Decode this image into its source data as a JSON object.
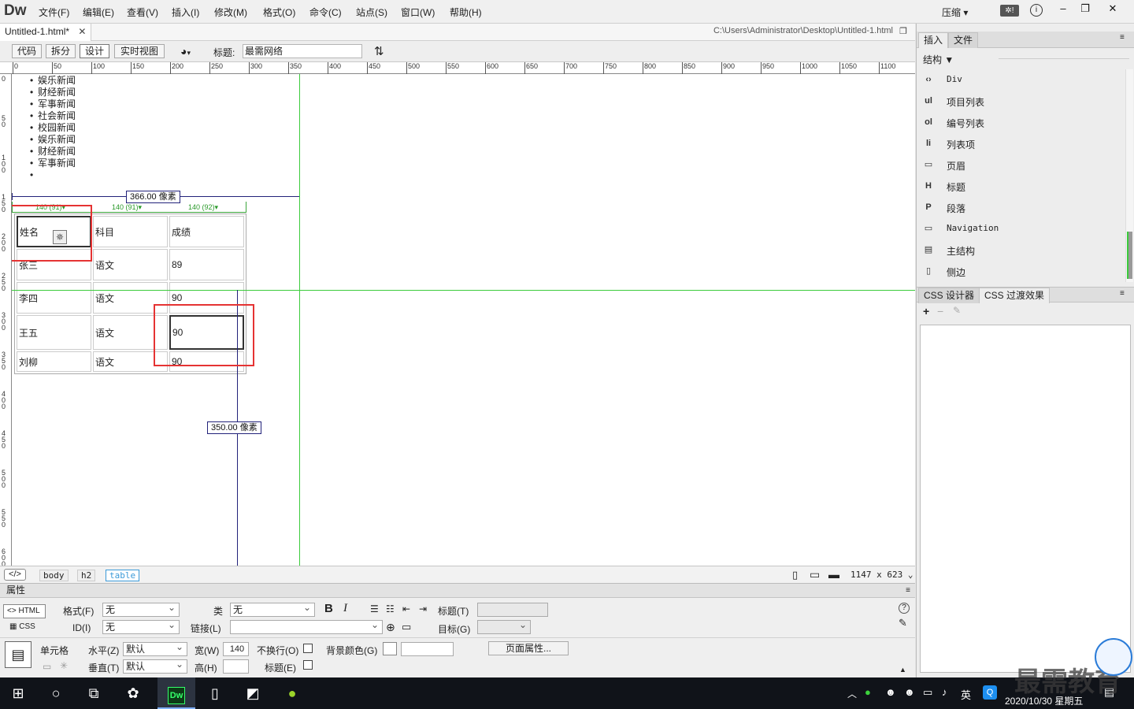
{
  "app": {
    "logo": "Dw",
    "menus": [
      "文件(F)",
      "编辑(E)",
      "查看(V)",
      "插入(I)",
      "修改(M)",
      "格式(O)",
      "命令(C)",
      "站点(S)",
      "窗口(W)",
      "帮助(H)"
    ],
    "compress_label": "压缩",
    "window_buttons": [
      "–",
      "❐",
      "✕"
    ]
  },
  "document": {
    "tab_title": "Untitled-1.html*",
    "file_path": "C:\\Users\\Administrator\\Desktop\\Untitled-1.html"
  },
  "toolbar": {
    "view_buttons": [
      "代码",
      "拆分",
      "设计",
      "实时视图"
    ],
    "title_label": "标题:",
    "title_value": "最需网络"
  },
  "ruler": {
    "h_ticks": [
      "0",
      "50",
      "100",
      "150",
      "200",
      "250",
      "300",
      "350",
      "400",
      "450",
      "500",
      "550",
      "600",
      "650",
      "700",
      "750",
      "800",
      "850",
      "900",
      "950",
      "1000",
      "1050",
      "1100"
    ],
    "v_ticks": [
      "0",
      "5 0",
      "1 0 0",
      "1 5 0",
      "2 0 0",
      "2 5 0",
      "3 0 0",
      "3 5 0",
      "4 0 0",
      "4 5 0",
      "5 0 0",
      "5 5 0",
      "6 0 0"
    ]
  },
  "canvas": {
    "list_items": [
      "娱乐新闻",
      "财经新闻",
      "军事新闻",
      "社会新闻",
      "校园新闻",
      "娱乐新闻",
      "财经新闻",
      "军事新闻",
      ""
    ],
    "width_measure": "366.00 像素",
    "height_measure": "350.00 像素",
    "column_widths": [
      "140 (91)",
      "140 (91)",
      "140 (92)"
    ],
    "table": [
      [
        "姓名",
        "科目",
        "成绩"
      ],
      [
        "张三",
        "语文",
        "89"
      ],
      [
        "李四",
        "语文",
        "90"
      ],
      [
        "王五",
        "语文",
        "90"
      ],
      [
        "刘柳",
        "语文",
        "90"
      ]
    ]
  },
  "status": {
    "tags": [
      "body",
      "h2",
      "table"
    ],
    "size": "1147 x 623"
  },
  "properties": {
    "header": "属性",
    "html_btn": "HTML",
    "css_btn": "CSS",
    "format_label": "格式(F)",
    "format_value": "无",
    "id_label": "ID(I)",
    "id_value": "无",
    "class_label": "类",
    "class_value": "无",
    "link_label": "链接(L)",
    "title_label": "标题(T)",
    "target_label": "目标(G)",
    "cell_label": "单元格",
    "horz_label": "水平(Z)",
    "horz_value": "默认",
    "vert_label": "垂直(T)",
    "vert_value": "默认",
    "width_label": "宽(W)",
    "width_value": "140",
    "height_label": "高(H)",
    "nowrap_label": "不换行(O)",
    "header_label": "标题(E)",
    "bg_label": "背景颜色(G)",
    "page_props": "页面属性..."
  },
  "panel": {
    "tabs": [
      "插入",
      "文件"
    ],
    "category": "结构",
    "items": [
      {
        "icon": "‹›",
        "label": "Div"
      },
      {
        "icon": "ul",
        "label": "项目列表"
      },
      {
        "icon": "ol",
        "label": "编号列表"
      },
      {
        "icon": "li",
        "label": "列表项"
      },
      {
        "icon": "▭",
        "label": "页眉"
      },
      {
        "icon": "H",
        "label": "标题"
      },
      {
        "icon": "P",
        "label": "段落"
      },
      {
        "icon": "▭",
        "label": "Navigation"
      },
      {
        "icon": "▤",
        "label": "主结构"
      },
      {
        "icon": "▯",
        "label": "侧边"
      }
    ],
    "css_tabs": [
      "CSS 设计器",
      "CSS 过渡效果"
    ]
  },
  "taskbar": {
    "time": "",
    "date": "2020/10/30 星期五",
    "ime": "英",
    "watermark": "最需教育"
  }
}
